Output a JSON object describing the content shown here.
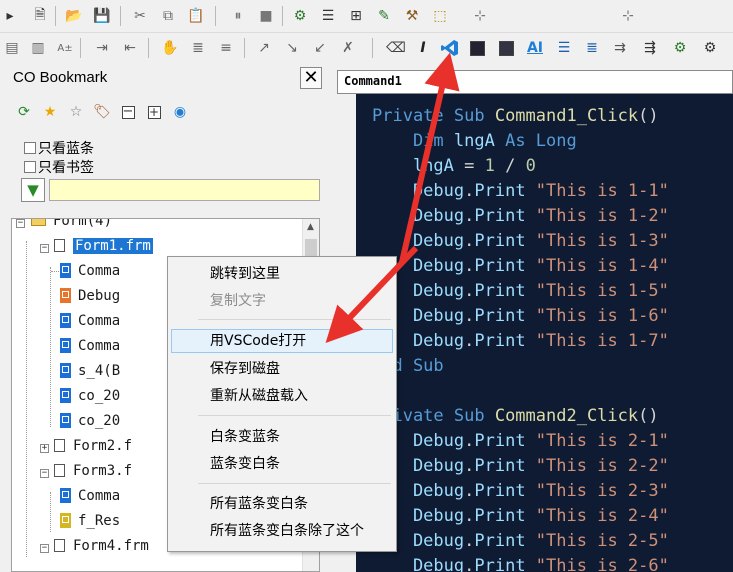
{
  "panel": {
    "title": "CO Bookmark",
    "close_label": "✕",
    "checkbox_blue_only": "只看蓝条",
    "checkbox_bookmark_only": "只看书签"
  },
  "tree": {
    "nodes": [
      {
        "label": "Form(4)",
        "type": "folder"
      },
      {
        "label": "Form1.frm",
        "type": "file",
        "selected": true
      },
      {
        "label": "Comma",
        "type": "bookmark-blue"
      },
      {
        "label": "Debug",
        "type": "bookmark-orange"
      },
      {
        "label": "Comma",
        "type": "bookmark-blue"
      },
      {
        "label": "Comma",
        "type": "bookmark-blue"
      },
      {
        "label": "s_4(B",
        "type": "bookmark-blue"
      },
      {
        "label": "co_20",
        "type": "bookmark-blue"
      },
      {
        "label": "co_20",
        "type": "bookmark-blue"
      },
      {
        "label": "Form2.f",
        "type": "file"
      },
      {
        "label": "Form3.f",
        "type": "file"
      },
      {
        "label": "Comma",
        "type": "bookmark-blue"
      },
      {
        "label": "f_Res",
        "type": "bookmark-yellow"
      },
      {
        "label": "Form4.frm",
        "type": "file"
      }
    ]
  },
  "editor": {
    "tab_label": "Command1",
    "lines": [
      "Private Sub Command1_Click()",
      "    Dim lngA As Long",
      "    lngA = 1 / 0",
      "    Debug.Print \"This is 1-1\"",
      "    Debug.Print \"This is 1-2\"",
      "    Debug.Print \"This is 1-3\"",
      "    Debug.Print \"This is 1-4\"",
      "    Debug.Print \"This is 1-5\"",
      "    Debug.Print \"This is 1-6\"",
      "    Debug.Print \"This is 1-7\"",
      "End Sub",
      "",
      "Private Sub Command2_Click()",
      "    Debug.Print \"This is 2-1\"",
      "    Debug.Print \"This is 2-2\"",
      "    Debug.Print \"This is 2-3\"",
      "    Debug.Print \"This is 2-4\"",
      "    Debug.Print \"This is 2-5\"",
      "    Debug.Print \"This is 2-6\""
    ]
  },
  "context_menu": {
    "items": [
      {
        "label": "跳转到这里",
        "enabled": true
      },
      {
        "label": "复制文字",
        "enabled": false
      },
      {
        "label": "用VSCode打开",
        "enabled": true,
        "highlighted": true
      },
      {
        "label": "保存到磁盘",
        "enabled": true
      },
      {
        "label": "重新从磁盘载入",
        "enabled": true
      },
      {
        "label": "白条变蓝条",
        "enabled": true
      },
      {
        "label": "蓝条变白条",
        "enabled": true
      },
      {
        "label": "所有蓝条变白条",
        "enabled": true
      },
      {
        "label": "所有蓝条变白条除了这个",
        "enabled": true
      }
    ]
  },
  "colors": {
    "editor_bg": "#0f1b33",
    "selection": "#1c76d2",
    "annotation_arrow": "#e8312a",
    "filter_bg": "#ffffc6"
  }
}
